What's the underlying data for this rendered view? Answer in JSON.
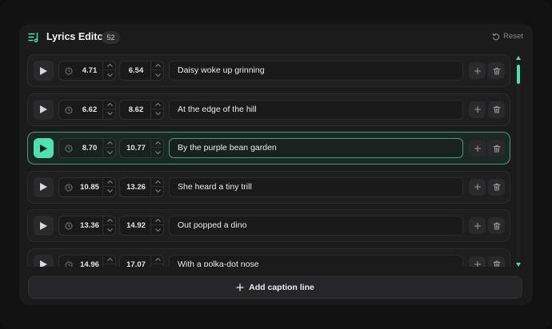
{
  "header": {
    "title": "Lyrics Editor",
    "count": "52",
    "reset_label": "Reset"
  },
  "rows": [
    {
      "start": "4.71",
      "end": "6.54",
      "text": "Daisy woke up grinning",
      "active": false
    },
    {
      "start": "6.62",
      "end": "8.62",
      "text": "At the edge of the hill",
      "active": false
    },
    {
      "start": "8.70",
      "end": "10.77",
      "text": "By the purple bean garden",
      "active": true
    },
    {
      "start": "10.85",
      "end": "13.26",
      "text": "She heard a tiny trill",
      "active": false
    },
    {
      "start": "13.36",
      "end": "14.92",
      "text": "Out popped a dino",
      "active": false
    },
    {
      "start": "14.96",
      "end": "17.07",
      "text": "With a polka-dot nose",
      "active": false
    }
  ],
  "footer": {
    "add_label": "Add caption line"
  },
  "colors": {
    "accent": "#4ee0b0",
    "active_border": "#3f9f80",
    "panel_bg": "#1b1b1c",
    "row_bg": "#1f1f20"
  },
  "icons": {
    "title": "lyrics-list-icon",
    "reset": "rotate-ccw-icon",
    "play": "play-icon",
    "clock": "clock-icon",
    "up": "chevron-up-icon",
    "down": "chevron-down-icon",
    "add": "plus-icon",
    "delete": "trash-icon"
  }
}
